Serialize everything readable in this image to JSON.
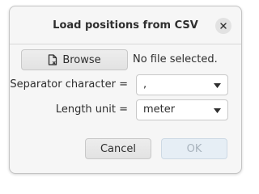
{
  "dialog": {
    "title": "Load positions from CSV",
    "close_icon": "close-icon"
  },
  "file": {
    "browse_label": "Browse",
    "browse_icon": "file-icon",
    "status": "No file selected."
  },
  "separator": {
    "label": "Separator character =",
    "value": ","
  },
  "length_unit": {
    "label": "Length unit =",
    "value": "meter"
  },
  "actions": {
    "cancel_label": "Cancel",
    "ok_label": "OK",
    "ok_enabled": false
  }
}
